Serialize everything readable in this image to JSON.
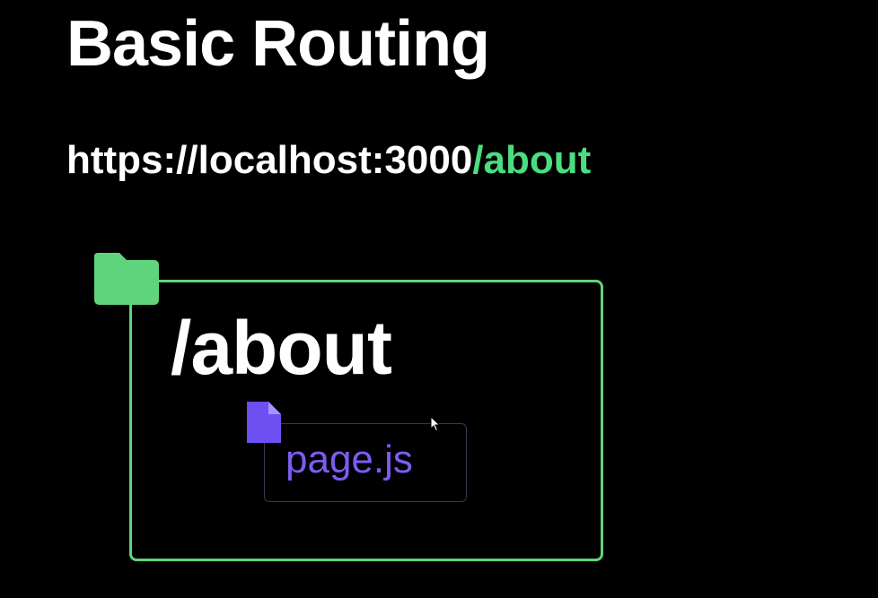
{
  "title": "Basic Routing",
  "url": {
    "base": "https://localhost:3000",
    "route": "/about"
  },
  "folder": {
    "label": "/about",
    "icon": "folder-icon",
    "color": "#5fd47c"
  },
  "file": {
    "label": "page.js",
    "icon": "file-icon",
    "color": "#7b5cf0"
  },
  "colors": {
    "background": "#000000",
    "accent_green": "#4ade80",
    "accent_purple": "#7b5cf0"
  }
}
